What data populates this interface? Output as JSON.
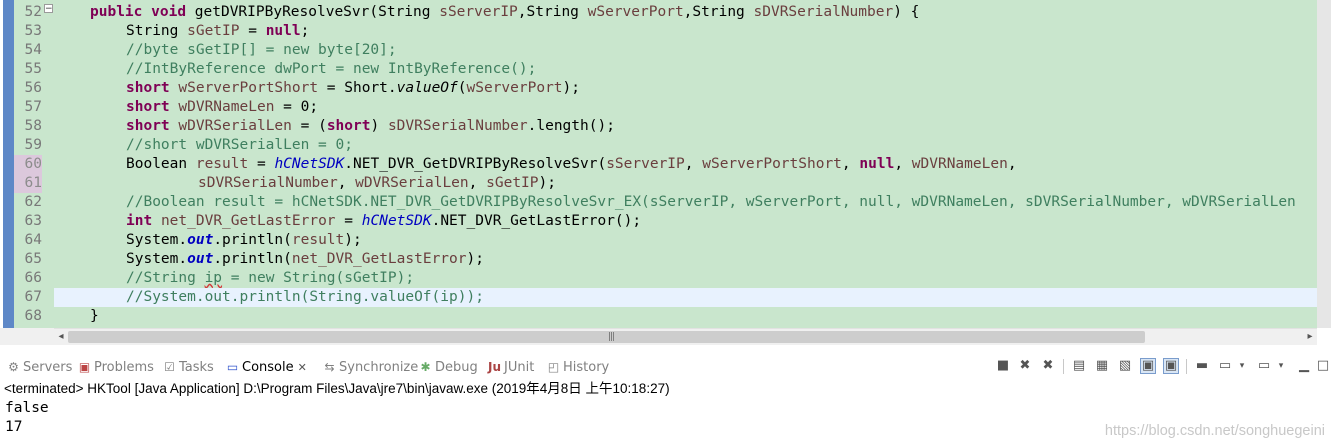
{
  "editor": {
    "line_numbers": [
      "52",
      "53",
      "54",
      "55",
      "56",
      "57",
      "58",
      "59",
      "60",
      "61",
      "62",
      "63",
      "64",
      "65",
      "66",
      "67",
      "68"
    ],
    "line52_sig": "getDVRIPByResolveSvr(String ",
    "lines_text": {
      "l53_type": "String ",
      "l53_var": "sGetIP",
      "l53_rest": " = ",
      "l53_null": "null",
      "l54": "//byte sGetIP[] = new byte[20];",
      "l55": "//IntByReference dwPort = new IntByReference();",
      "l67": "//System.out.println(String.valueOf(ip));"
    }
  },
  "tabs": [
    {
      "label": "Servers",
      "icon": "servers-icon"
    },
    {
      "label": "Problems",
      "icon": "problems-icon"
    },
    {
      "label": "Tasks",
      "icon": "tasks-icon"
    },
    {
      "label": "Console",
      "icon": "console-icon"
    },
    {
      "label": "Synchronize",
      "icon": "synchronize-icon"
    },
    {
      "label": "Debug",
      "icon": "debug-icon"
    },
    {
      "label": "JUnit",
      "icon": "junit-icon"
    },
    {
      "label": "History",
      "icon": "history-icon"
    }
  ],
  "console": {
    "status": "<terminated> HKTool [Java Application] D:\\Program Files\\Java\\jre7\\bin\\javaw.exe (2019年4月8日 上午10:18:27)",
    "output": [
      "false",
      "17"
    ]
  },
  "watermark": "https://blog.csdn.net/songhuegeini",
  "colors": {
    "editor_bg": "#c9e6cd",
    "keyword": "#7f0055",
    "comment": "#3f7f5f",
    "field": "#0000c0",
    "current_line": "#e8f2fe"
  }
}
